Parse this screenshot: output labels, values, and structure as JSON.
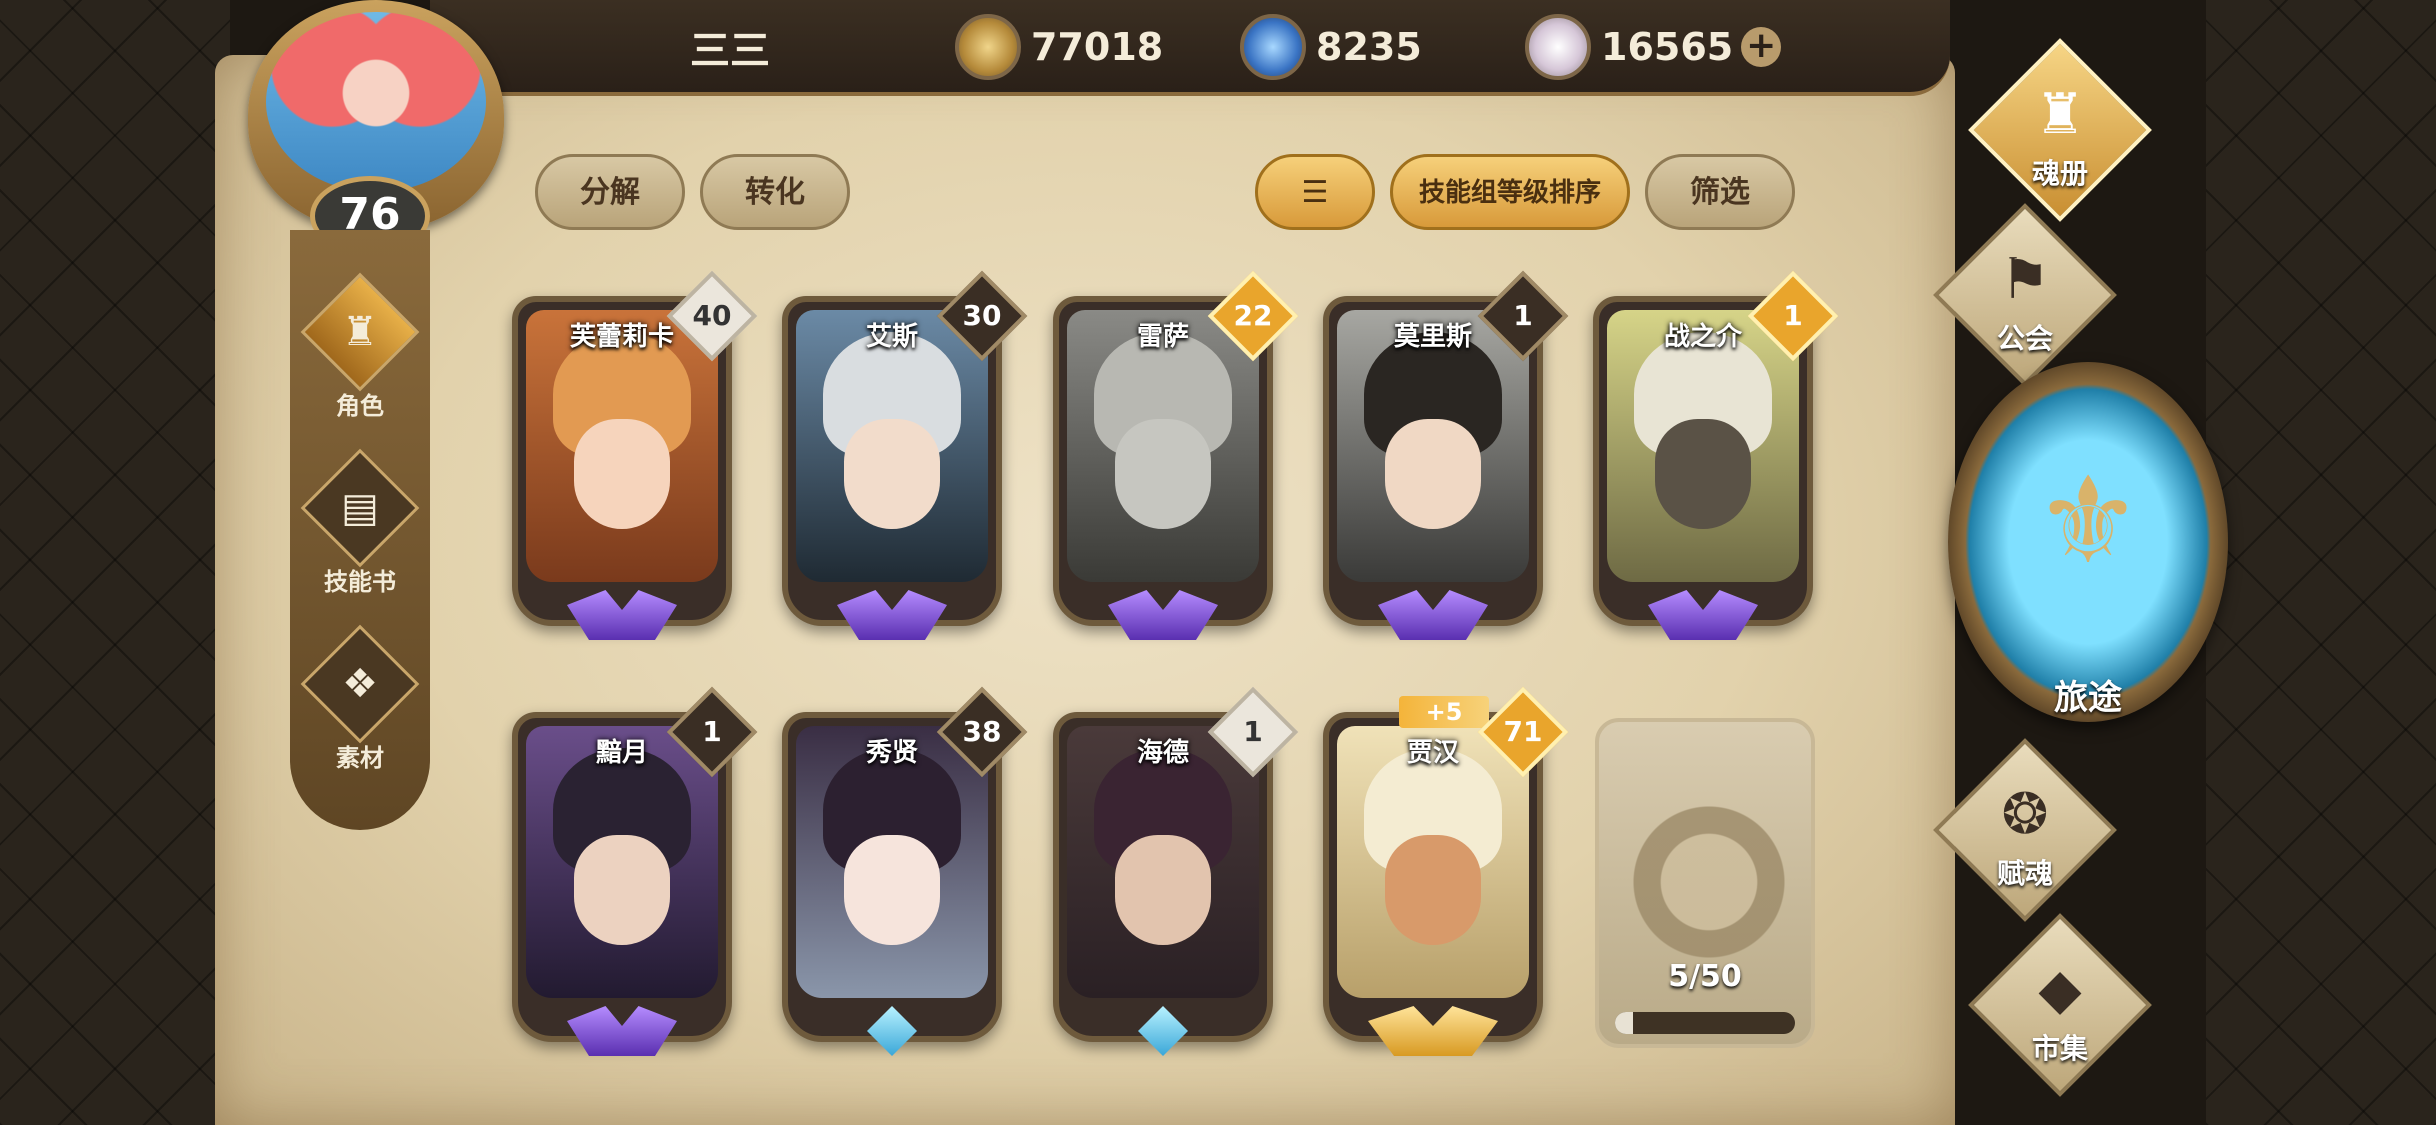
{
  "header": {
    "player_name": "三三",
    "level": "76",
    "currencies": [
      {
        "icon": "gold-coin-icon",
        "value": "77018"
      },
      {
        "icon": "blue-crystal-icon",
        "value": "8235"
      },
      {
        "icon": "gem-icon",
        "value": "16565"
      }
    ],
    "add_label": "+"
  },
  "left_nav": [
    {
      "label": "角色",
      "icon": "helmet-icon",
      "active": true
    },
    {
      "label": "技能书",
      "icon": "book-icon",
      "active": false
    },
    {
      "label": "素材",
      "icon": "material-icon",
      "active": false
    }
  ],
  "toolbar": {
    "decompose": "分解",
    "convert": "转化",
    "sort_icon": "sort-icon",
    "sort_label": "技能组等级排序",
    "filter_label": "筛选"
  },
  "characters": [
    {
      "name": "芙蕾莉卡",
      "level": "40"
    },
    {
      "name": "艾斯",
      "level": "30"
    },
    {
      "name": "雷萨",
      "level": "22"
    },
    {
      "name": "莫里斯",
      "level": "1"
    },
    {
      "name": "战之介",
      "level": "1"
    },
    {
      "name": "黯月",
      "level": "1"
    },
    {
      "name": "秀贤",
      "level": "38"
    },
    {
      "name": "海德",
      "level": "1"
    },
    {
      "name": "贾汉",
      "level": "71",
      "bonus": "+5"
    }
  ],
  "slot": {
    "count": "5/50",
    "fill_fraction": 0.1
  },
  "right_menu": {
    "soul_book": "魂册",
    "guild": "公会",
    "journey": "旅途",
    "endow_soul": "赋魂",
    "market": "市集"
  }
}
